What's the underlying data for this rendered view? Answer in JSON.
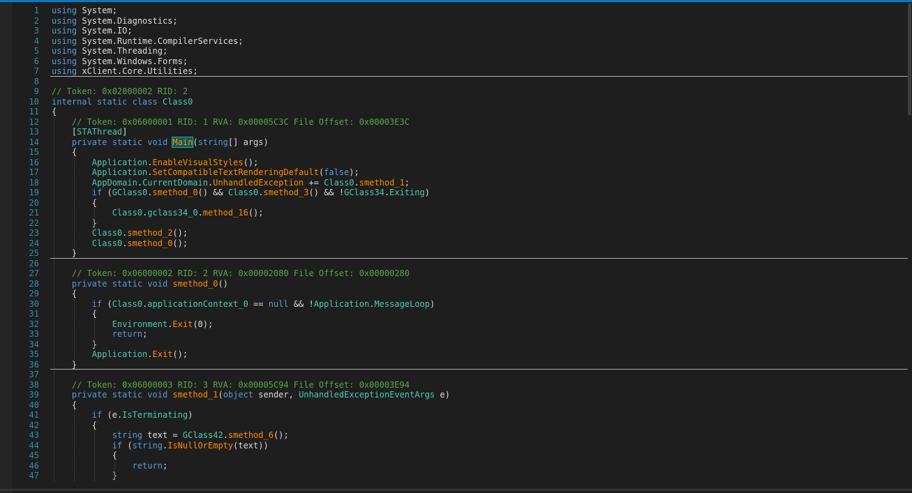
{
  "editor": {
    "lines": [
      {
        "n": "1",
        "tokens": [
          [
            "kw",
            "using"
          ],
          [
            "pu",
            " "
          ],
          [
            "ns",
            "System"
          ],
          [
            "pu",
            ";"
          ]
        ]
      },
      {
        "n": "2",
        "tokens": [
          [
            "kw",
            "using"
          ],
          [
            "pu",
            " "
          ],
          [
            "ns",
            "System.Diagnostics"
          ],
          [
            "pu",
            ";"
          ]
        ]
      },
      {
        "n": "3",
        "tokens": [
          [
            "kw",
            "using"
          ],
          [
            "pu",
            " "
          ],
          [
            "ns",
            "System.IO"
          ],
          [
            "pu",
            ";"
          ]
        ]
      },
      {
        "n": "4",
        "tokens": [
          [
            "kw",
            "using"
          ],
          [
            "pu",
            " "
          ],
          [
            "ns",
            "System.Runtime.CompilerServices"
          ],
          [
            "pu",
            ";"
          ]
        ]
      },
      {
        "n": "5",
        "tokens": [
          [
            "kw",
            "using"
          ],
          [
            "pu",
            " "
          ],
          [
            "ns",
            "System.Threading"
          ],
          [
            "pu",
            ";"
          ]
        ]
      },
      {
        "n": "6",
        "tokens": [
          [
            "kw",
            "using"
          ],
          [
            "pu",
            " "
          ],
          [
            "ns",
            "System.Windows.Forms"
          ],
          [
            "pu",
            ";"
          ]
        ]
      },
      {
        "n": "7",
        "tokens": [
          [
            "kw",
            "using"
          ],
          [
            "pu",
            " "
          ],
          [
            "ns",
            "xClient.Core.Utilities"
          ],
          [
            "pu",
            ";"
          ]
        ]
      },
      {
        "n": "8",
        "tokens": []
      },
      {
        "n": "9",
        "tokens": [
          [
            "cm",
            "// Token: 0x02000002 RID: 2"
          ]
        ]
      },
      {
        "n": "10",
        "tokens": [
          [
            "kw",
            "internal static class"
          ],
          [
            "pu",
            " "
          ],
          [
            "ty",
            "Class0"
          ]
        ]
      },
      {
        "n": "11",
        "tokens": [
          [
            "pu",
            "{"
          ]
        ]
      },
      {
        "n": "12",
        "tokens": [
          [
            "pu",
            "    "
          ],
          [
            "cm",
            "// Token: 0x06000001 RID: 1 RVA: 0x00005C3C File Offset: 0x00003E3C"
          ]
        ]
      },
      {
        "n": "13",
        "tokens": [
          [
            "pu",
            "    ["
          ],
          [
            "ty",
            "STAThread"
          ],
          [
            "pu",
            "]"
          ]
        ]
      },
      {
        "n": "14",
        "tokens": [
          [
            "pu",
            "    "
          ],
          [
            "kw",
            "private static void"
          ],
          [
            "pu",
            " "
          ],
          [
            "hl",
            "Main"
          ],
          [
            "pu",
            "("
          ],
          [
            "kw",
            "string"
          ],
          [
            "pu",
            "[] "
          ],
          [
            "lo",
            "args"
          ],
          [
            "pu",
            ")"
          ]
        ]
      },
      {
        "n": "15",
        "tokens": [
          [
            "pu",
            "    {"
          ]
        ]
      },
      {
        "n": "16",
        "tokens": [
          [
            "pu",
            "        "
          ],
          [
            "ty",
            "Application"
          ],
          [
            "pu",
            "."
          ],
          [
            "me",
            "EnableVisualStyles"
          ],
          [
            "pu",
            "();"
          ]
        ]
      },
      {
        "n": "17",
        "tokens": [
          [
            "pu",
            "        "
          ],
          [
            "ty",
            "Application"
          ],
          [
            "pu",
            "."
          ],
          [
            "me",
            "SetCompatibleTextRenderingDefault"
          ],
          [
            "pu",
            "("
          ],
          [
            "kw",
            "false"
          ],
          [
            "pu",
            ");"
          ]
        ]
      },
      {
        "n": "18",
        "tokens": [
          [
            "pu",
            "        "
          ],
          [
            "ty",
            "AppDomain"
          ],
          [
            "pu",
            "."
          ],
          [
            "pr",
            "CurrentDomain"
          ],
          [
            "pu",
            "."
          ],
          [
            "me",
            "UnhandledException"
          ],
          [
            "pu",
            " += "
          ],
          [
            "ty",
            "Class0"
          ],
          [
            "pu",
            "."
          ],
          [
            "me",
            "smethod_1"
          ],
          [
            "pu",
            ";"
          ]
        ]
      },
      {
        "n": "19",
        "tokens": [
          [
            "pu",
            "        "
          ],
          [
            "kw",
            "if"
          ],
          [
            "pu",
            " ("
          ],
          [
            "ty",
            "GClass0"
          ],
          [
            "pu",
            "."
          ],
          [
            "me",
            "smethod_0"
          ],
          [
            "pu",
            "() && "
          ],
          [
            "ty",
            "Class0"
          ],
          [
            "pu",
            "."
          ],
          [
            "me",
            "smethod_3"
          ],
          [
            "pu",
            "() && !"
          ],
          [
            "ty",
            "GClass34"
          ],
          [
            "pu",
            "."
          ],
          [
            "pr",
            "Exiting"
          ],
          [
            "pu",
            ")"
          ]
        ]
      },
      {
        "n": "20",
        "tokens": [
          [
            "pu",
            "        {"
          ]
        ]
      },
      {
        "n": "21",
        "tokens": [
          [
            "pu",
            "            "
          ],
          [
            "ty",
            "Class0"
          ],
          [
            "pu",
            "."
          ],
          [
            "ty",
            "gclass34_0"
          ],
          [
            "pu",
            "."
          ],
          [
            "me",
            "method_16"
          ],
          [
            "pu",
            "();"
          ]
        ]
      },
      {
        "n": "22",
        "tokens": [
          [
            "pu",
            "        }"
          ]
        ]
      },
      {
        "n": "23",
        "tokens": [
          [
            "pu",
            "        "
          ],
          [
            "ty",
            "Class0"
          ],
          [
            "pu",
            "."
          ],
          [
            "me",
            "smethod_2"
          ],
          [
            "pu",
            "();"
          ]
        ]
      },
      {
        "n": "24",
        "tokens": [
          [
            "pu",
            "        "
          ],
          [
            "ty",
            "Class0"
          ],
          [
            "pu",
            "."
          ],
          [
            "me",
            "smethod_0"
          ],
          [
            "pu",
            "();"
          ]
        ]
      },
      {
        "n": "25",
        "tokens": [
          [
            "pu",
            "    }"
          ]
        ]
      },
      {
        "n": "26",
        "tokens": []
      },
      {
        "n": "27",
        "tokens": [
          [
            "pu",
            "    "
          ],
          [
            "cm",
            "// Token: 0x06000002 RID: 2 RVA: 0x00002080 File Offset: 0x00000280"
          ]
        ]
      },
      {
        "n": "28",
        "tokens": [
          [
            "pu",
            "    "
          ],
          [
            "kw",
            "private static void"
          ],
          [
            "pu",
            " "
          ],
          [
            "me",
            "smethod_0"
          ],
          [
            "pu",
            "()"
          ]
        ]
      },
      {
        "n": "29",
        "tokens": [
          [
            "pu",
            "    {"
          ]
        ]
      },
      {
        "n": "30",
        "tokens": [
          [
            "pu",
            "        "
          ],
          [
            "kw",
            "if"
          ],
          [
            "pu",
            " ("
          ],
          [
            "ty",
            "Class0"
          ],
          [
            "pu",
            "."
          ],
          [
            "ty",
            "applicationContext_0"
          ],
          [
            "pu",
            " == "
          ],
          [
            "kw",
            "null"
          ],
          [
            "pu",
            " && !"
          ],
          [
            "ty",
            "Application"
          ],
          [
            "pu",
            "."
          ],
          [
            "pr",
            "MessageLoop"
          ],
          [
            "pu",
            ")"
          ]
        ]
      },
      {
        "n": "31",
        "tokens": [
          [
            "pu",
            "        {"
          ]
        ]
      },
      {
        "n": "32",
        "tokens": [
          [
            "pu",
            "            "
          ],
          [
            "ty",
            "Environment"
          ],
          [
            "pu",
            "."
          ],
          [
            "me",
            "Exit"
          ],
          [
            "pu",
            "(0);"
          ]
        ]
      },
      {
        "n": "33",
        "tokens": [
          [
            "pu",
            "            "
          ],
          [
            "kw",
            "return"
          ],
          [
            "pu",
            ";"
          ]
        ]
      },
      {
        "n": "34",
        "tokens": [
          [
            "pu",
            "        }"
          ]
        ]
      },
      {
        "n": "35",
        "tokens": [
          [
            "pu",
            "        "
          ],
          [
            "ty",
            "Application"
          ],
          [
            "pu",
            "."
          ],
          [
            "me",
            "Exit"
          ],
          [
            "pu",
            "();"
          ]
        ]
      },
      {
        "n": "36",
        "tokens": [
          [
            "pu",
            "    }"
          ]
        ]
      },
      {
        "n": "37",
        "tokens": []
      },
      {
        "n": "38",
        "tokens": [
          [
            "pu",
            "    "
          ],
          [
            "cm",
            "// Token: 0x06000003 RID: 3 RVA: 0x00005C94 File Offset: 0x00003E94"
          ]
        ]
      },
      {
        "n": "39",
        "tokens": [
          [
            "pu",
            "    "
          ],
          [
            "kw",
            "private static void"
          ],
          [
            "pu",
            " "
          ],
          [
            "me",
            "smethod_1"
          ],
          [
            "pu",
            "("
          ],
          [
            "kw",
            "object"
          ],
          [
            "pu",
            " "
          ],
          [
            "lo",
            "sender"
          ],
          [
            "pu",
            ", "
          ],
          [
            "ty",
            "UnhandledExceptionEventArgs"
          ],
          [
            "pu",
            " "
          ],
          [
            "lo",
            "e"
          ],
          [
            "pu",
            ")"
          ]
        ]
      },
      {
        "n": "40",
        "tokens": [
          [
            "pu",
            "    {"
          ]
        ]
      },
      {
        "n": "41",
        "tokens": [
          [
            "pu",
            "        "
          ],
          [
            "kw",
            "if"
          ],
          [
            "pu",
            " ("
          ],
          [
            "lo",
            "e"
          ],
          [
            "pu",
            "."
          ],
          [
            "pr",
            "IsTerminating"
          ],
          [
            "pu",
            ")"
          ]
        ]
      },
      {
        "n": "42",
        "tokens": [
          [
            "pu",
            "        {"
          ]
        ]
      },
      {
        "n": "43",
        "tokens": [
          [
            "pu",
            "            "
          ],
          [
            "kw",
            "string"
          ],
          [
            "pu",
            " "
          ],
          [
            "lo",
            "text"
          ],
          [
            "pu",
            " = "
          ],
          [
            "ty",
            "GClass42"
          ],
          [
            "pu",
            "."
          ],
          [
            "me",
            "smethod_6"
          ],
          [
            "pu",
            "();"
          ]
        ]
      },
      {
        "n": "44",
        "tokens": [
          [
            "pu",
            "            "
          ],
          [
            "kw",
            "if"
          ],
          [
            "pu",
            " ("
          ],
          [
            "kw",
            "string"
          ],
          [
            "pu",
            "."
          ],
          [
            "me",
            "IsNullOrEmpty"
          ],
          [
            "pu",
            "("
          ],
          [
            "lo",
            "text"
          ],
          [
            "pu",
            "))"
          ]
        ]
      },
      {
        "n": "45",
        "tokens": [
          [
            "pu",
            "            {"
          ]
        ]
      },
      {
        "n": "46",
        "tokens": [
          [
            "pu",
            "                "
          ],
          [
            "kw",
            "return"
          ],
          [
            "pu",
            ";"
          ]
        ]
      },
      {
        "n": "47",
        "tokens": [
          [
            "pu",
            "            }"
          ]
        ]
      }
    ]
  }
}
